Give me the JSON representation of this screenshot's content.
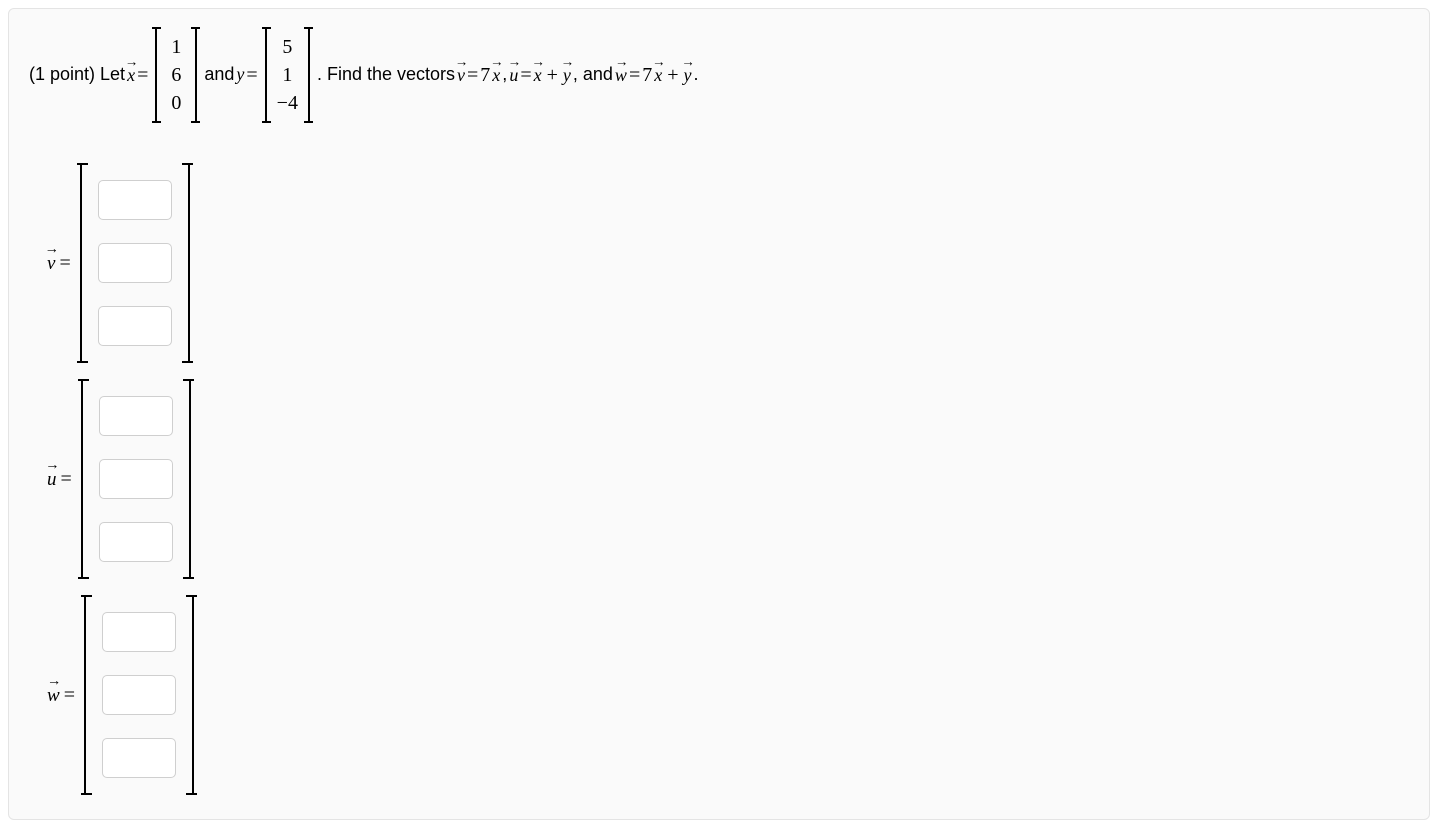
{
  "question": {
    "prefix": "(1 point) Let ",
    "x_var": "x",
    "y_var": "y",
    "eq": "=",
    "and": " and ",
    "find_text": ". Find the vectors ",
    "comma": ", ",
    "and_word": ", and ",
    "period": ".",
    "vec_x": [
      "1",
      "6",
      "0"
    ],
    "vec_y": [
      "5",
      "1",
      "−4"
    ],
    "v": "v",
    "u": "u",
    "w": "w",
    "seven": "7",
    "plus": "+",
    "y_sym": "y",
    "x_sym": "x"
  },
  "answers": {
    "v_label": "v",
    "u_label": "u",
    "w_label": "w",
    "eq": "=",
    "inputs_per_vector": 3
  }
}
